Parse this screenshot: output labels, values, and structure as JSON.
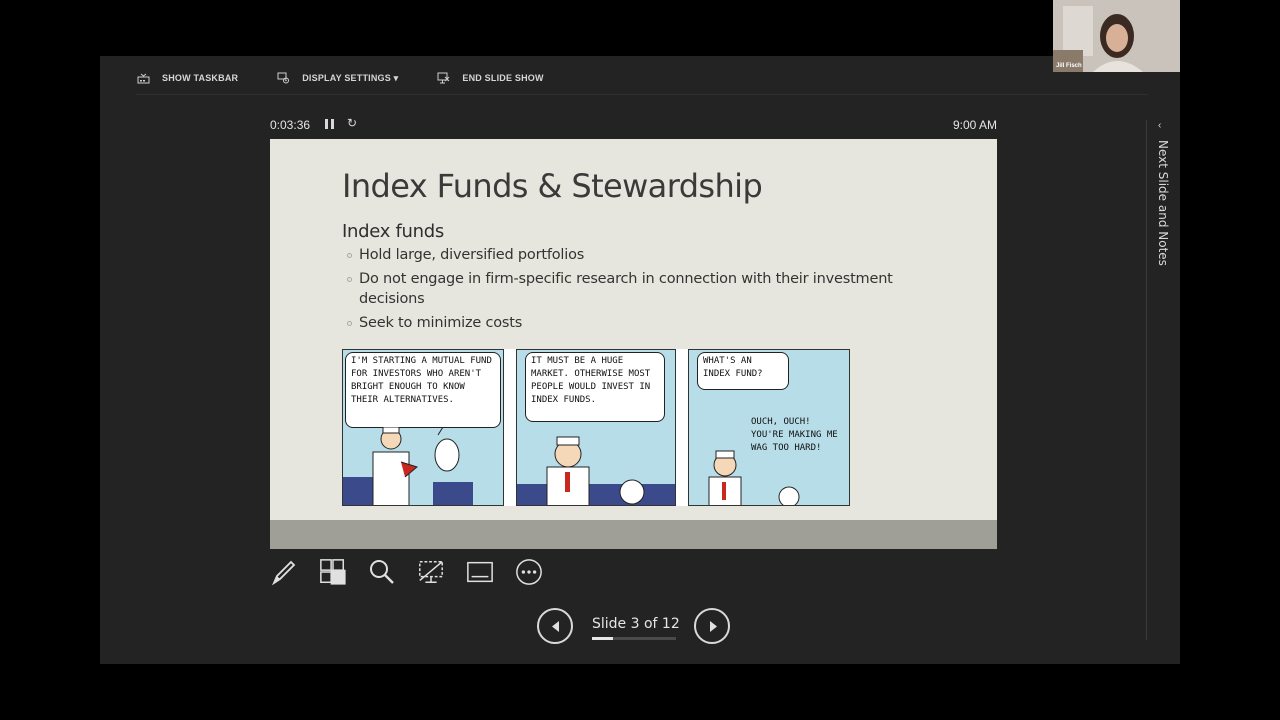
{
  "toolbar": {
    "show_taskbar": "SHOW TASKBAR",
    "display_settings": "DISPLAY SETTINGS ▾",
    "end_slide_show": "END SLIDE SHOW"
  },
  "status": {
    "timer": "0:03:36",
    "reset_glyph": "↻",
    "clock": "9:00 AM"
  },
  "slide": {
    "title": "Index Funds & Stewardship",
    "subheading": "Index funds",
    "bullets": [
      "Hold large, diversified portfolios",
      "Do not engage in firm-specific research in connection with their investment decisions",
      "Seek to minimize costs"
    ],
    "comic": {
      "panel1_bubble": "I'm starting a mutual fund for investors who aren't bright enough to know their alternatives.",
      "panel2_bubble": "It must be a huge market. Otherwise most people would invest in index funds.",
      "panel3_bubble": "What's an index fund?",
      "panel3_reply": "Ouch, ouch! You're making me wag too hard!"
    }
  },
  "tools": [
    "pen-icon",
    "see-all-slides-icon",
    "zoom-icon",
    "black-screen-icon",
    "subtitles-icon",
    "more-options-icon"
  ],
  "navigation": {
    "counter": "Slide 3 of 12",
    "progress": 0.25
  },
  "side_panel": {
    "label": "Next Slide and Notes",
    "collapse_glyph": "‹"
  },
  "webcam": {
    "name": "Jill Fisch"
  },
  "colors": {
    "background": "#232323",
    "slide_bg": "#e7e6de",
    "comic_sky": "#b7dde8"
  }
}
